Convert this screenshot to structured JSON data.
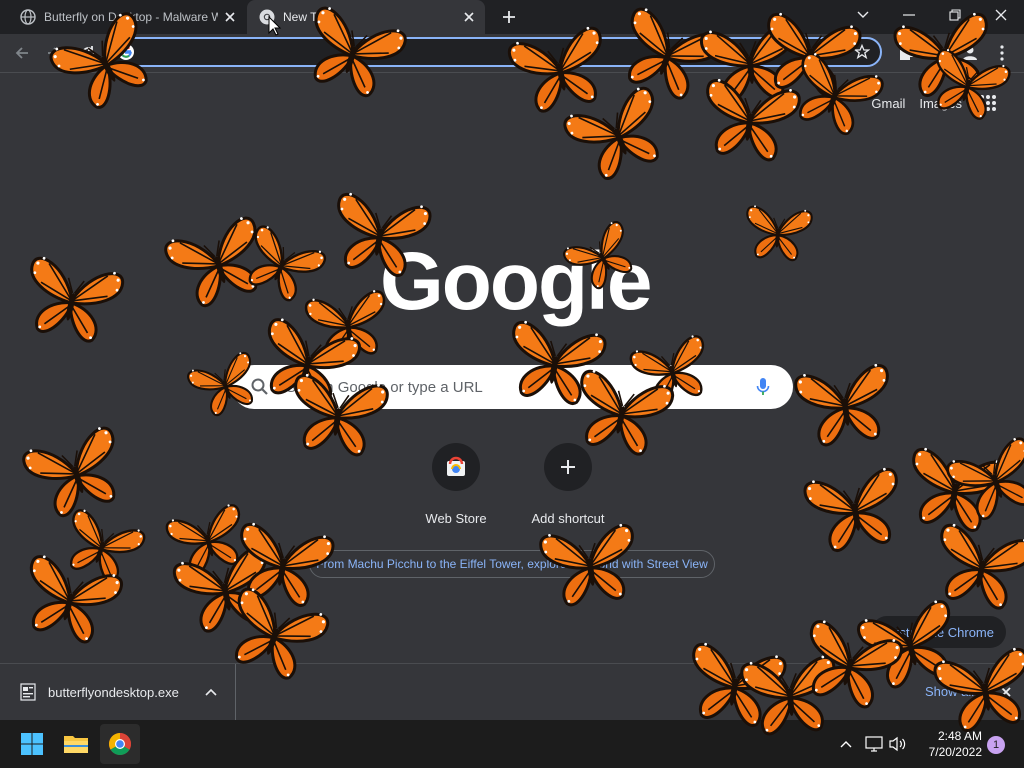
{
  "browser": {
    "tabs": [
      {
        "title": "Butterfly on Desktop - Malware Warn",
        "active": false
      },
      {
        "title": "New Tab",
        "active": true
      }
    ],
    "omnibox_value": ""
  },
  "ntp": {
    "header_links": [
      "Gmail",
      "Images"
    ],
    "logo_text": "Google",
    "search_placeholder": "Search Google or type a URL",
    "shortcuts": [
      {
        "label": "Web Store"
      },
      {
        "label": "Add shortcut"
      }
    ],
    "promo_text": "From Machu Picchu to the Eiffel Tower, explore the world with Street View",
    "customize_label": "Customize Chrome"
  },
  "download_bar": {
    "filename": "butterflyondesktop.exe",
    "show_all_label": "Show all"
  },
  "taskbar": {
    "time": "2:48 AM",
    "date": "7/20/2022",
    "notification_count": "1"
  },
  "colors": {
    "accent": "#8ab4f8",
    "butterfly_orange": "#f47a16",
    "butterfly_dark": "#1a0f08"
  }
}
